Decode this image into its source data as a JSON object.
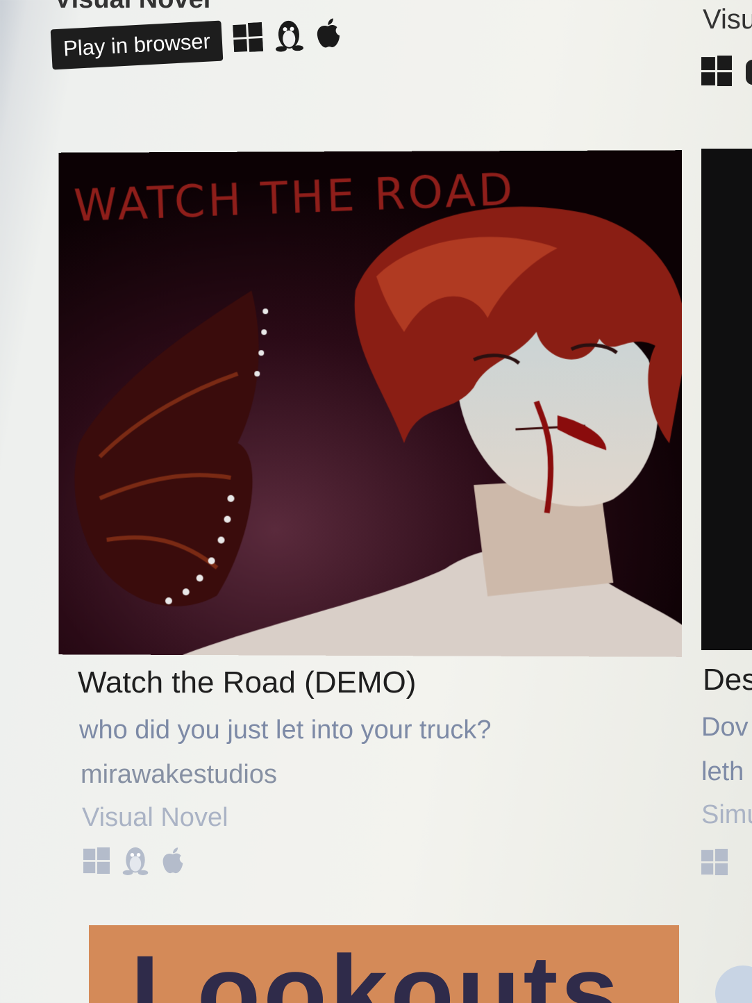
{
  "top_row": {
    "genre_partial": "Visual Novel",
    "play_button": "Play in browser",
    "platforms": [
      "windows-icon",
      "linux-icon",
      "apple-icon"
    ],
    "right_genre_partial": "Visu"
  },
  "main_card": {
    "thumbnail_text": "WATCH THE ROAD",
    "title": "Watch the Road (DEMO)",
    "description": "who did you just let into your truck?",
    "author": "mirawakestudios",
    "genre": "Visual Novel",
    "platforms": [
      "windows-icon",
      "linux-icon",
      "apple-icon"
    ]
  },
  "right_card": {
    "title_partial": "Des",
    "description_line1": "Dov",
    "description_line2": "leth",
    "genre_partial": "Simu",
    "platforms": [
      "windows-icon"
    ]
  },
  "next_card": {
    "thumbnail_text": "Lookouts"
  },
  "colors": {
    "title": "#1e1e1e",
    "description": "#7d8aa6",
    "genre": "#aab3c5",
    "thumb_text": "#8e1e1a",
    "play_button_bg": "#1d1d1d"
  }
}
